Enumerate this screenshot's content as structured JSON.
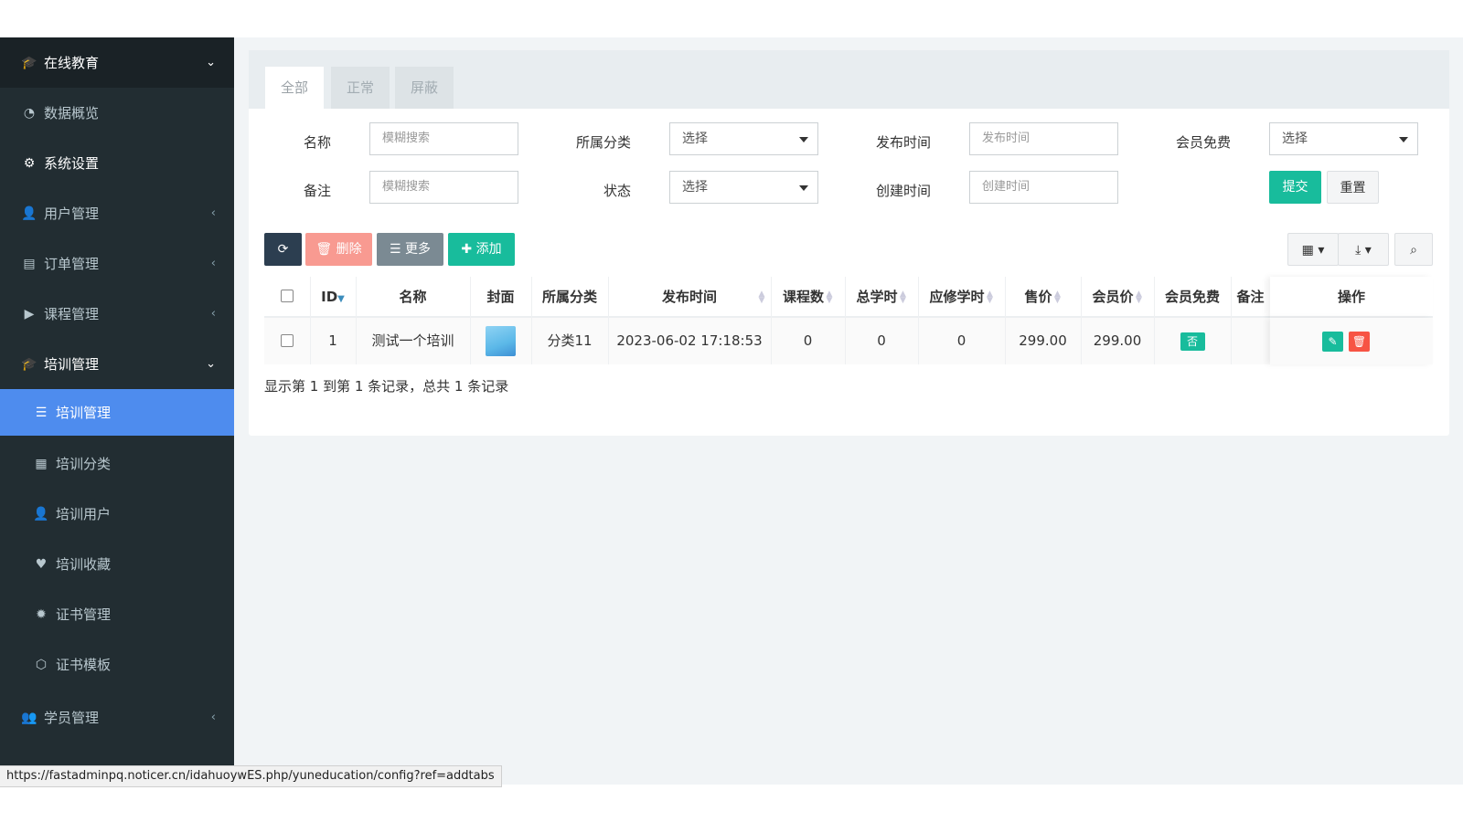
{
  "sidebar": {
    "items": [
      {
        "label": "在线教育",
        "icon": "graduation-icon",
        "arrow": "⌄"
      },
      {
        "label": "数据概览",
        "icon": "dashboard-icon",
        "arrow": ""
      },
      {
        "label": "系统设置",
        "icon": "gears-icon",
        "arrow": ""
      },
      {
        "label": "用户管理",
        "icon": "user-icon",
        "arrow": "‹"
      },
      {
        "label": "订单管理",
        "icon": "list-alt-icon",
        "arrow": "‹"
      },
      {
        "label": "课程管理",
        "icon": "play-circle-icon",
        "arrow": "‹"
      },
      {
        "label": "培训管理",
        "icon": "graduation-icon",
        "arrow": "⌄"
      },
      {
        "label": "培训管理",
        "icon": "list-icon",
        "arrow": ""
      },
      {
        "label": "培训分类",
        "icon": "grid-icon",
        "arrow": ""
      },
      {
        "label": "培训用户",
        "icon": "user-icon",
        "arrow": ""
      },
      {
        "label": "培训收藏",
        "icon": "heart-icon",
        "arrow": ""
      },
      {
        "label": "证书管理",
        "icon": "certificate-icon",
        "arrow": ""
      },
      {
        "label": "证书模板",
        "icon": "cube-icon",
        "arrow": ""
      },
      {
        "label": "学员管理",
        "icon": "users-icon",
        "arrow": "‹"
      }
    ]
  },
  "tabs": [
    "全部",
    "正常",
    "屏蔽"
  ],
  "filters": {
    "name_label": "名称",
    "name_placeholder": "模糊搜索",
    "category_label": "所属分类",
    "category_value": "选择",
    "publish_label": "发布时间",
    "publish_placeholder": "发布时间",
    "member_free_label": "会员免费",
    "member_free_value": "选择",
    "remark_label": "备注",
    "remark_placeholder": "模糊搜索",
    "status_label": "状态",
    "status_value": "选择",
    "created_label": "创建时间",
    "created_placeholder": "创建时间",
    "submit": "提交",
    "reset": "重置"
  },
  "toolbar": {
    "delete": "删除",
    "more": "更多",
    "add": "添加"
  },
  "table": {
    "headers": [
      "ID",
      "名称",
      "封面",
      "所属分类",
      "发布时间",
      "课程数",
      "总学时",
      "应修学时",
      "售价",
      "会员价",
      "会员免费",
      "备注",
      "操作"
    ],
    "rows": [
      {
        "id": "1",
        "name": "测试一个培训",
        "category": "分类11",
        "publish": "2023-06-02 17:18:53",
        "courses": "0",
        "total_hours": "0",
        "required_hours": "0",
        "price": "299.00",
        "member_price": "299.00",
        "member_free": "否",
        "remark": ""
      }
    ]
  },
  "pagination_text": "显示第 1 到第 1 条记录，总共 1 条记录",
  "status_url": "https://fastadminpq.noticer.cn/idahuoywES.php/yuneducation/config?ref=addtabs",
  "colors": {
    "sidebar_bg": "#222d32",
    "active": "#4e8cee",
    "success": "#18bc9c",
    "danger": "#f75444",
    "dark_btn": "#2c3e50"
  }
}
